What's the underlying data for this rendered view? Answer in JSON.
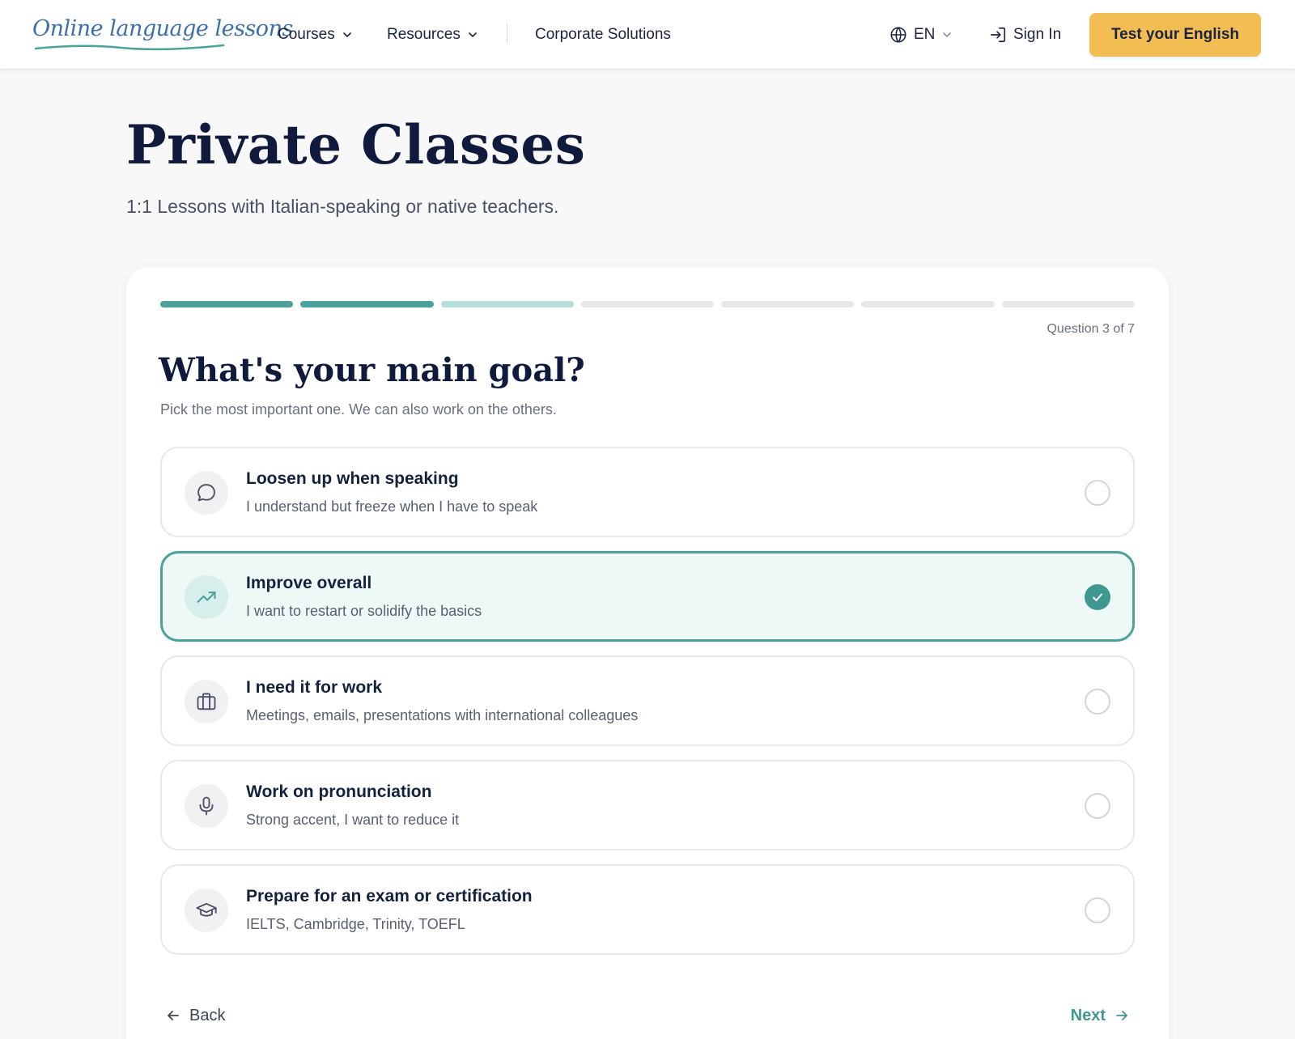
{
  "header": {
    "logo_text": "Online language lessons",
    "nav": {
      "courses": "Courses",
      "resources": "Resources",
      "corporate": "Corporate Solutions"
    },
    "language": "EN",
    "sign_in": "Sign In",
    "cta": "Test your English"
  },
  "hero": {
    "title": "Private Classes",
    "subtitle": "1:1 Lessons with Italian-speaking or native teachers."
  },
  "quiz": {
    "progress": {
      "total_steps": 7,
      "completed_steps": 2,
      "current_step": 3
    },
    "question_count": "Question 3 of 7",
    "title": "What's your main goal?",
    "subtitle": "Pick the most important one. We can also work on the others.",
    "options": [
      {
        "title": "Loosen up when speaking",
        "desc": "I understand but freeze when I have to speak",
        "icon": "speech-bubble-icon",
        "selected": false
      },
      {
        "title": "Improve overall",
        "desc": "I want to restart or solidify the basics",
        "icon": "trending-up-icon",
        "selected": true
      },
      {
        "title": "I need it for work",
        "desc": "Meetings, emails, presentations with international colleagues",
        "icon": "briefcase-icon",
        "selected": false
      },
      {
        "title": "Work on pronunciation",
        "desc": "Strong accent, I want to reduce it",
        "icon": "microphone-icon",
        "selected": false
      },
      {
        "title": "Prepare for an exam or certification",
        "desc": "IELTS, Cambridge, Trinity, TOEFL",
        "icon": "graduation-cap-icon",
        "selected": false
      }
    ],
    "back_label": "Back",
    "next_label": "Next"
  },
  "colors": {
    "accent": "#4aa29a",
    "accent_light": "#b6dedd",
    "selected_bg": "#edf8f7",
    "cta": "#f2bd52",
    "heading": "#0f1a3d"
  }
}
